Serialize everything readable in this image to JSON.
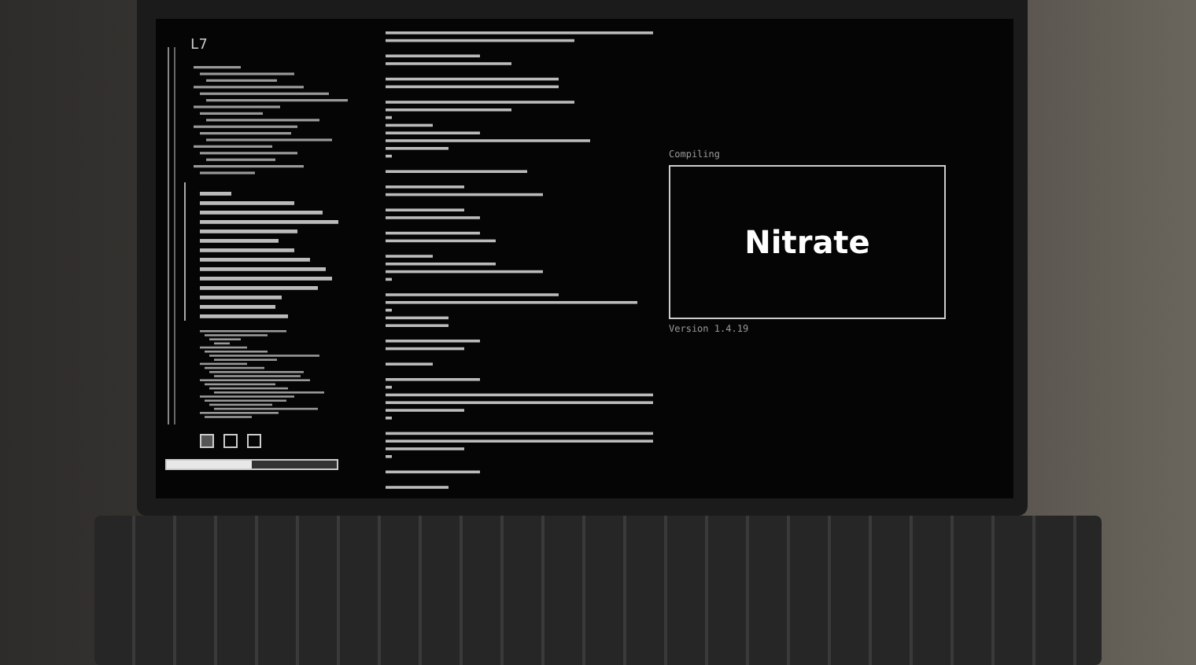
{
  "screen": {
    "sidebar": {
      "header": "L7",
      "progress": {
        "level": 0.5
      }
    },
    "status": {
      "label": "Compiling",
      "title": "Nitrate",
      "version": "Version 1.4.19"
    }
  }
}
